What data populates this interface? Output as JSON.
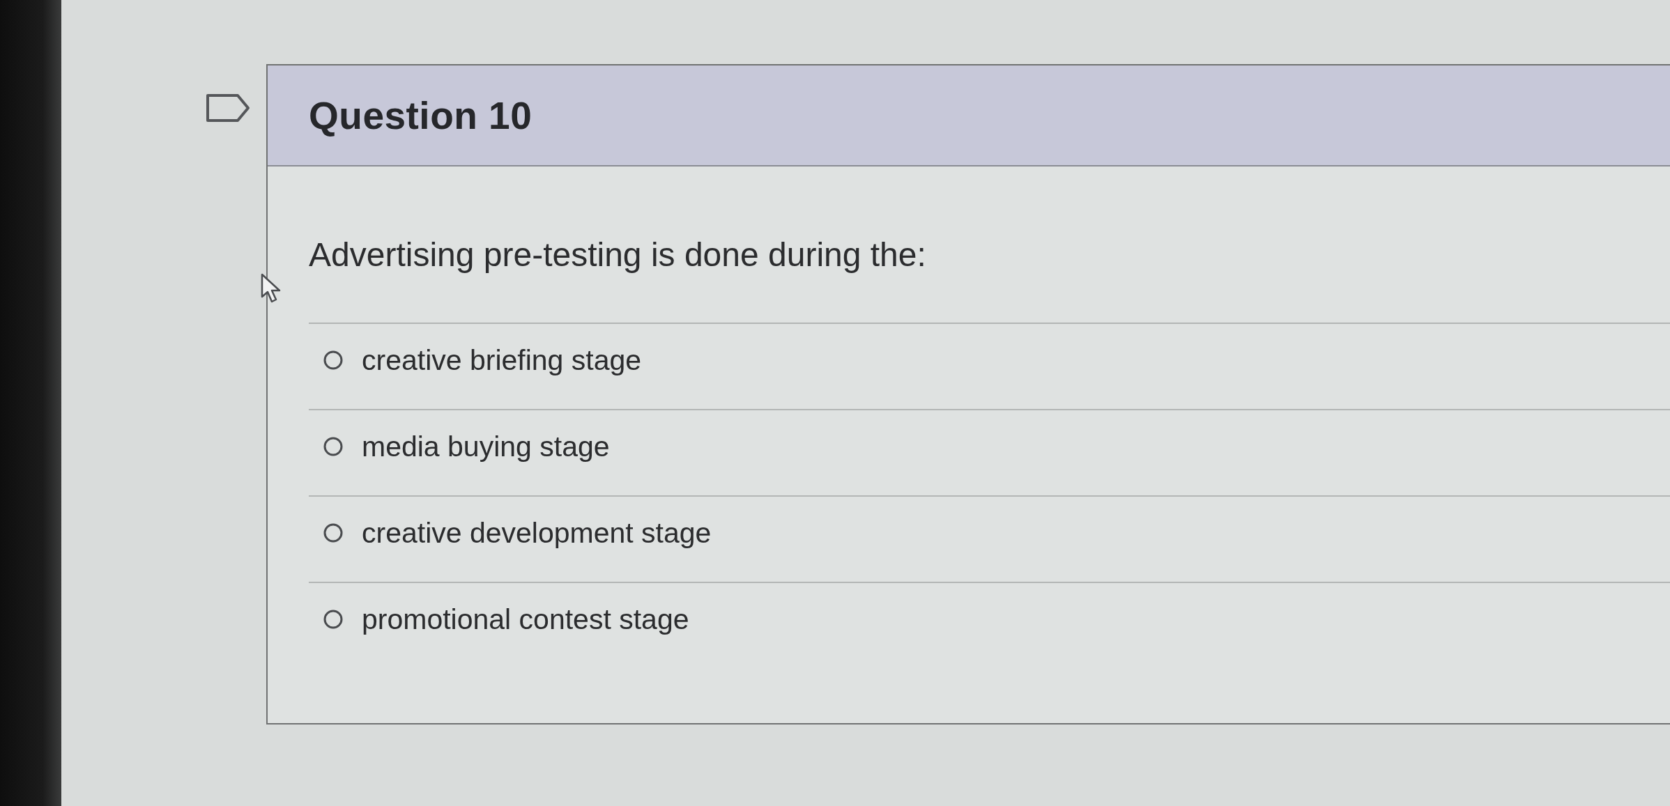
{
  "question": {
    "title": "Question 10",
    "prompt": "Advertising pre-testing is done during the:",
    "options": [
      {
        "label": "creative briefing stage",
        "selected": false
      },
      {
        "label": "media buying stage",
        "selected": false
      },
      {
        "label": "creative development stage",
        "selected": false
      },
      {
        "label": "promotional contest stage",
        "selected": false
      }
    ]
  }
}
